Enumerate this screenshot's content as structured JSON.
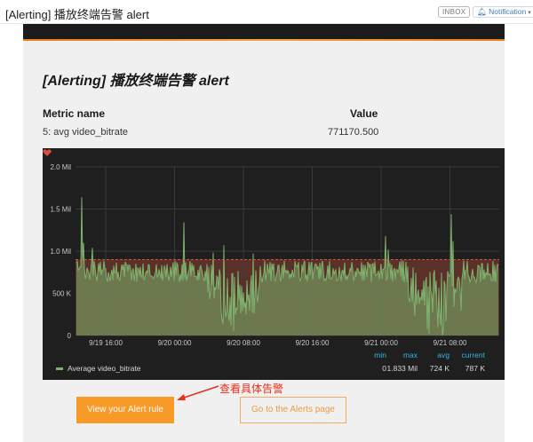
{
  "email": {
    "subject": "[Alerting] 播放终端告警 alert",
    "inbox_label": "INBOX",
    "notification_label": "Notification"
  },
  "alert": {
    "title": "[Alerting] 播放终端告警 alert",
    "metric_header": "Metric name",
    "value_header": "Value",
    "metric_name": "5: avg video_bitrate",
    "metric_value": "771170.500"
  },
  "chart_data": {
    "type": "area",
    "y_ticks": [
      "2.0 Mil",
      "1.5 Mil",
      "1.0 Mil",
      "500 K",
      "0"
    ],
    "y_tick_values": [
      2000000,
      1500000,
      1000000,
      500000,
      0
    ],
    "x_ticks": [
      "9/19 16:00",
      "9/20 00:00",
      "9/20 08:00",
      "9/20 16:00",
      "9/21 00:00",
      "9/21 08:00"
    ],
    "ylim": [
      0,
      2000000
    ],
    "threshold": 900000,
    "grid": true,
    "series": [
      {
        "name": "Average video_bitrate",
        "color": "#7eb26d"
      }
    ],
    "legend_stats": {
      "headers": [
        "min",
        "max",
        "avg",
        "current"
      ],
      "values": [
        "0",
        "1.833 Mil",
        "724 K",
        "787 K"
      ]
    }
  },
  "annotation": "查看具体告警",
  "buttons": {
    "view_rule": "View your Alert rule",
    "go_alerts": "Go to the Alerts page"
  },
  "colors": {
    "accent": "#f79a28",
    "series": "#7eb26d",
    "threshold_fill": "#5a3129",
    "threshold_line": "#e24d42",
    "annotation": "#e8301c"
  }
}
